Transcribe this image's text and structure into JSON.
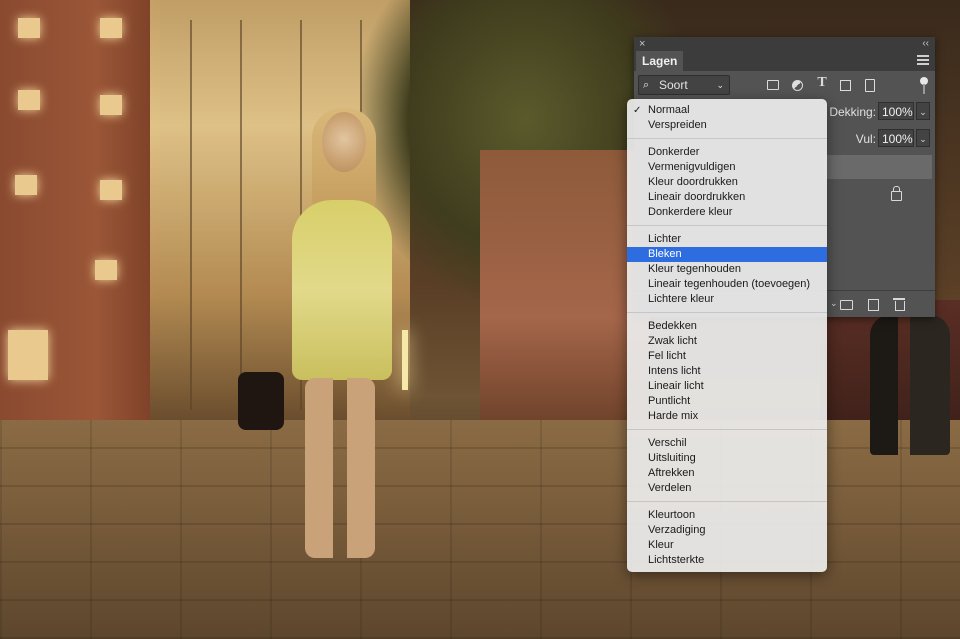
{
  "panel": {
    "tab_label": "Lagen",
    "close_glyph": "×",
    "collapse_glyph": "‹‹",
    "filter": {
      "kind_label": "Soort",
      "search_glyph": "⌕",
      "chevron_glyph": "⌄"
    },
    "opacity": {
      "label": "Dekking:",
      "value": "100%",
      "chevron_glyph": "⌄"
    },
    "fill": {
      "label": "Vul:",
      "value": "100%",
      "chevron_glyph": "⌄"
    },
    "filter_icons": [
      "image-filter-icon",
      "adjustment-filter-icon",
      "type-filter-icon",
      "shape-filter-icon",
      "smart-object-filter-icon"
    ],
    "type_glyph": "T",
    "footer_chevron": "⌄"
  },
  "blend_menu": {
    "checked_index": 0,
    "highlighted_index": 8,
    "groups": [
      [
        "Normaal",
        "Verspreiden"
      ],
      [
        "Donkerder",
        "Vermenigvuldigen",
        "Kleur doordrukken",
        "Lineair doordrukken",
        "Donkerdere kleur"
      ],
      [
        "Lichter",
        "Bleken",
        "Kleur tegenhouden",
        "Lineair tegenhouden (toevoegen)",
        "Lichtere kleur"
      ],
      [
        "Bedekken",
        "Zwak licht",
        "Fel licht",
        "Intens licht",
        "Lineair licht",
        "Puntlicht",
        "Harde mix"
      ],
      [
        "Verschil",
        "Uitsluiting",
        "Aftrekken",
        "Verdelen"
      ],
      [
        "Kleurtoon",
        "Verzadiging",
        "Kleur",
        "Lichtsterkte"
      ]
    ],
    "check_glyph": "✓"
  },
  "colors": {
    "panel_bg": "#535353",
    "menu_highlight": "#2d6ddf",
    "menu_bg": "#ececec"
  }
}
